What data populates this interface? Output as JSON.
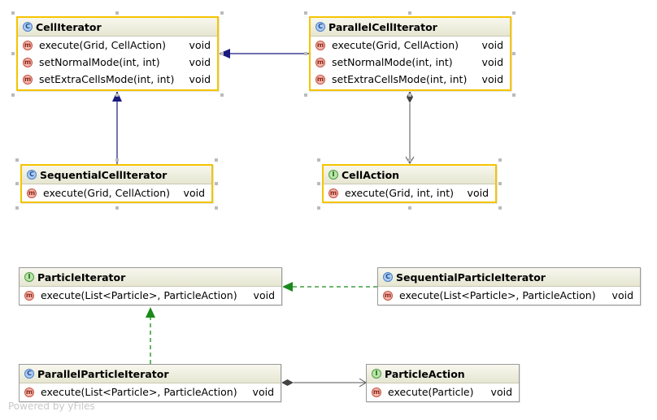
{
  "classes": [
    {
      "id": "CellIterator",
      "name": "CellIterator",
      "kind": "abstract",
      "methods": [
        {
          "name": "execute(Grid, CellAction)",
          "type": "void"
        },
        {
          "name": "setNormalMode(int, int)",
          "type": "void"
        },
        {
          "name": "setExtraCellsMode(int, int)",
          "type": "void"
        }
      ]
    },
    {
      "id": "ParallelCellIterator",
      "name": "ParallelCellIterator",
      "kind": "class",
      "methods": [
        {
          "name": "execute(Grid, CellAction)",
          "type": "void"
        },
        {
          "name": "setNormalMode(int, int)",
          "type": "void"
        },
        {
          "name": "setExtraCellsMode(int, int)",
          "type": "void"
        }
      ]
    },
    {
      "id": "SequentialCellIterator",
      "name": "SequentialCellIterator",
      "kind": "class",
      "methods": [
        {
          "name": "execute(Grid, CellAction)",
          "type": "void"
        }
      ]
    },
    {
      "id": "CellAction",
      "name": "CellAction",
      "kind": "interface",
      "methods": [
        {
          "name": "execute(Grid, int, int)",
          "type": "void"
        }
      ]
    },
    {
      "id": "ParticleIterator",
      "name": "ParticleIterator",
      "kind": "interface",
      "methods": [
        {
          "name": "execute(List<Particle>, ParticleAction)",
          "type": "void"
        }
      ]
    },
    {
      "id": "SequentialParticleIterator",
      "name": "SequentialParticleIterator",
      "kind": "class",
      "methods": [
        {
          "name": "execute(List<Particle>, ParticleAction)",
          "type": "void"
        }
      ]
    },
    {
      "id": "ParallelParticleIterator",
      "name": "ParallelParticleIterator",
      "kind": "class",
      "methods": [
        {
          "name": "execute(List<Particle>, ParticleAction)",
          "type": "void"
        }
      ]
    },
    {
      "id": "ParticleAction",
      "name": "ParticleAction",
      "kind": "interface",
      "methods": [
        {
          "name": "execute(Particle)",
          "type": "void"
        }
      ]
    }
  ],
  "relations": [
    {
      "from": "ParallelCellIterator",
      "to": "CellIterator",
      "type": "extends"
    },
    {
      "from": "SequentialCellIterator",
      "to": "CellIterator",
      "type": "extends"
    },
    {
      "from": "ParallelCellIterator",
      "to": "CellAction",
      "type": "composition"
    },
    {
      "from": "SequentialParticleIterator",
      "to": "ParticleIterator",
      "type": "implements"
    },
    {
      "from": "ParallelParticleIterator",
      "to": "ParticleIterator",
      "type": "implements"
    },
    {
      "from": "ParallelParticleIterator",
      "to": "ParticleAction",
      "type": "composition"
    }
  ],
  "colors": {
    "extends": "#1a1a80",
    "implements": "#1a8a1a",
    "composition": "#555555",
    "selection": "#f5c400"
  },
  "icons": {
    "abstract": "abstract-class-icon",
    "class": "class-icon",
    "interface": "interface-icon",
    "method": "method-icon"
  },
  "watermark": "Powered by yFiles"
}
